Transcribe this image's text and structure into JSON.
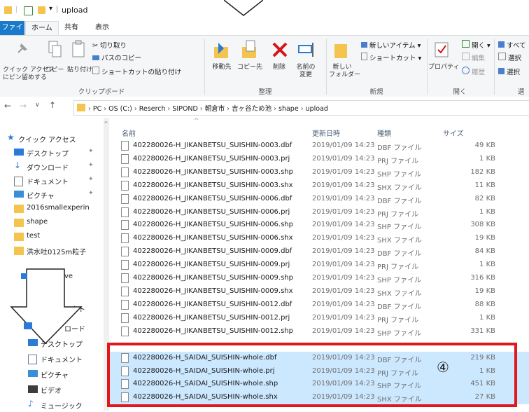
{
  "window": {
    "title": "upload"
  },
  "tabs": [
    "ファイル",
    "ホーム",
    "共有",
    "表示"
  ],
  "ribbon": {
    "clipboard": {
      "label": "クリップボード",
      "pin_quick": "クイック アクセス\nにピン留めする",
      "copy": "コピー",
      "paste": "貼り付け",
      "cut": "切り取り",
      "copy_path": "パスのコピー",
      "paste_shortcut": "ショートカットの貼り付け"
    },
    "organize": {
      "label": "整理",
      "move_to": "移動先",
      "copy_to": "コピー先",
      "delete": "削除",
      "rename": "名前の\n変更"
    },
    "new": {
      "label": "新規",
      "new_folder": "新しい\nフォルダー",
      "new_item": "新しいアイテム ▾",
      "shortcut": "ショートカット ▾"
    },
    "open": {
      "label": "開く",
      "properties": "プロパティ",
      "open": "開く ▾",
      "edit": "編集",
      "history": "履歴"
    },
    "select": {
      "all": "すべて",
      "sel1": "選択",
      "sel2": "選択",
      "label": "選"
    }
  },
  "address": {
    "crumbs": [
      "PC",
      "OS (C:)",
      "Reserch",
      "SIPOND",
      "朝倉市",
      "吉ヶ谷ため池",
      "shape",
      "upload"
    ]
  },
  "nav": {
    "items": [
      {
        "label": "クイック アクセス",
        "icon": "star-icon",
        "pinned": false
      },
      {
        "label": "デスクトップ",
        "icon": "desktop-icon",
        "pinned": true
      },
      {
        "label": "ダウンロード",
        "icon": "download-icon",
        "pinned": true
      },
      {
        "label": "ドキュメント",
        "icon": "document-icon",
        "pinned": true
      },
      {
        "label": "ピクチャ",
        "icon": "picture-icon",
        "pinned": true
      },
      {
        "label": "2016smallexperin",
        "icon": "folder-icon",
        "pinned": false
      },
      {
        "label": "shape",
        "icon": "folder-icon",
        "pinned": false
      },
      {
        "label": "test",
        "icon": "folder-icon",
        "pinned": false
      },
      {
        "label": "洪水吐0125m粒子",
        "icon": "folder-icon",
        "pinned": false
      }
    ],
    "lower_items": [
      {
        "label": "ve",
        "icon": "onedrive-icon"
      },
      {
        "label": "ェクト",
        "icon": "object-icon"
      },
      {
        "label": "ロード",
        "icon": "download-icon"
      },
      {
        "label": "デスクトップ",
        "icon": "desktop-icon"
      },
      {
        "label": "ドキュメント",
        "icon": "document-icon"
      },
      {
        "label": "ピクチャ",
        "icon": "picture-icon"
      },
      {
        "label": "ビデオ",
        "icon": "video-icon"
      },
      {
        "label": "ミュージック",
        "icon": "music-icon"
      }
    ]
  },
  "columns": {
    "name": "名前",
    "date": "更新日時",
    "type": "種類",
    "size": "サイズ"
  },
  "files": [
    {
      "name": "402280026-H_JIKANBETSU_SUISHIN-0003.dbf",
      "date": "2019/01/09 14:23",
      "type": "DBF ファイル",
      "size": "49 KB"
    },
    {
      "name": "402280026-H_JIKANBETSU_SUISHIN-0003.prj",
      "date": "2019/01/09 14:23",
      "type": "PRJ ファイル",
      "size": "1 KB"
    },
    {
      "name": "402280026-H_JIKANBETSU_SUISHIN-0003.shp",
      "date": "2019/01/09 14:23",
      "type": "SHP ファイル",
      "size": "182 KB"
    },
    {
      "name": "402280026-H_JIKANBETSU_SUISHIN-0003.shx",
      "date": "2019/01/09 14:23",
      "type": "SHX ファイル",
      "size": "11 KB"
    },
    {
      "name": "402280026-H_JIKANBETSU_SUISHIN-0006.dbf",
      "date": "2019/01/09 14:23",
      "type": "DBF ファイル",
      "size": "82 KB"
    },
    {
      "name": "402280026-H_JIKANBETSU_SUISHIN-0006.prj",
      "date": "2019/01/09 14:23",
      "type": "PRJ ファイル",
      "size": "1 KB"
    },
    {
      "name": "402280026-H_JIKANBETSU_SUISHIN-0006.shp",
      "date": "2019/01/09 14:23",
      "type": "SHP ファイル",
      "size": "308 KB"
    },
    {
      "name": "402280026-H_JIKANBETSU_SUISHIN-0006.shx",
      "date": "2019/01/09 14:23",
      "type": "SHX ファイル",
      "size": "19 KB"
    },
    {
      "name": "402280026-H_JIKANBETSU_SUISHIN-0009.dbf",
      "date": "2019/01/09 14:23",
      "type": "DBF ファイル",
      "size": "84 KB"
    },
    {
      "name": "402280026-H_JIKANBETSU_SUISHIN-0009.prj",
      "date": "2019/01/09 14:23",
      "type": "PRJ ファイル",
      "size": "1 KB"
    },
    {
      "name": "402280026-H_JIKANBETSU_SUISHIN-0009.shp",
      "date": "2019/01/09 14:23",
      "type": "SHP ファイル",
      "size": "316 KB"
    },
    {
      "name": "402280026-H_JIKANBETSU_SUISHIN-0009.shx",
      "date": "2019/01/09 14:23",
      "type": "SHX ファイル",
      "size": "19 KB"
    },
    {
      "name": "402280026-H_JIKANBETSU_SUISHIN-0012.dbf",
      "date": "2019/01/09 14:23",
      "type": "DBF ファイル",
      "size": "88 KB"
    },
    {
      "name": "402280026-H_JIKANBETSU_SUISHIN-0012.prj",
      "date": "2019/01/09 14:23",
      "type": "PRJ ファイル",
      "size": "1 KB"
    },
    {
      "name": "402280026-H_JIKANBETSU_SUISHIN-0012.shp",
      "date": "2019/01/09 14:23",
      "type": "SHP ファイル",
      "size": "331 KB"
    },
    {
      "name": "402280026-H_SAIDAI_SUISHIN-whole.dbf",
      "date": "2019/01/09 14:23",
      "type": "DBF ファイル",
      "size": "219 KB",
      "selected": true
    },
    {
      "name": "402280026-H_SAIDAI_SUISHIN-whole.prj",
      "date": "2019/01/09 14:23",
      "type": "PRJ ファイル",
      "size": "1 KB",
      "selected": true
    },
    {
      "name": "402280026-H_SAIDAI_SUISHIN-whole.shp",
      "date": "2019/01/09 14:23",
      "type": "SHP ファイル",
      "size": "451 KB",
      "selected": true
    },
    {
      "name": "402280026-H_SAIDAI_SUISHIN-whole.shx",
      "date": "2019/01/09 14:23",
      "type": "SHX ファイル",
      "size": "27 KB",
      "selected": true
    }
  ],
  "annotation": {
    "marker": "④",
    "highlight_color": "#e3161b"
  },
  "colors": {
    "accent": "#1979ca",
    "selection": "#cce8ff",
    "folder": "#f4c44e"
  }
}
